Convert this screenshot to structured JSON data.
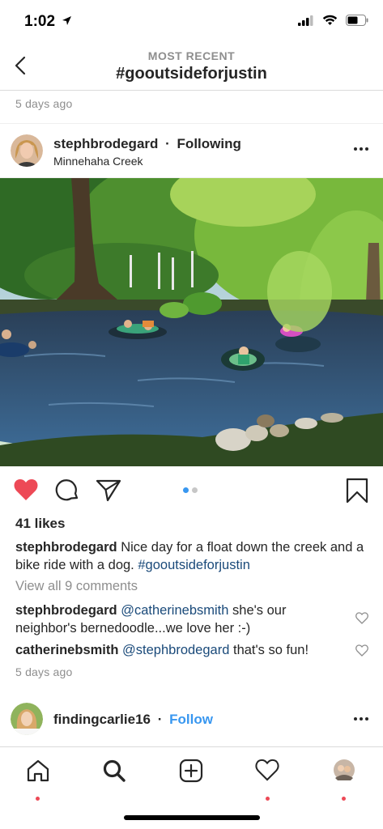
{
  "status_bar": {
    "time": "1:02"
  },
  "header": {
    "subtitle": "MOST RECENT",
    "title": "#gooutsideforjustin"
  },
  "top_timestamp": "5 days ago",
  "post": {
    "username": "stephbrodegard",
    "separator": "·",
    "follow_status": "Following",
    "location": "Minnehaha Creek",
    "carousel": {
      "count": 2,
      "active_index": 0
    },
    "liked": true,
    "likes": "41 likes",
    "caption": {
      "username": "stephbrodegard",
      "text": "Nice day for a float down the creek and a bike ride with a dog.",
      "hashtag": "#gooutsideforjustin"
    },
    "view_all_comments": "View all 9 comments",
    "comments": [
      {
        "username": "stephbrodegard",
        "mention": "@catherinebsmith",
        "text": "she's our neighbor's bernedoodle...we love her :-)"
      },
      {
        "username": "catherinebsmith",
        "mention": "@stephbrodegard",
        "text": "that's so fun!"
      }
    ],
    "timestamp": "5 days ago"
  },
  "next_post": {
    "username": "findingcarlie16",
    "separator": "·",
    "follow_label": "Follow"
  },
  "tab_bar": {
    "items": [
      {
        "icon": "home-icon",
        "notification_dot": true
      },
      {
        "icon": "search-icon",
        "notification_dot": false,
        "active": true
      },
      {
        "icon": "add-post-icon",
        "notification_dot": false
      },
      {
        "icon": "activity-heart-icon",
        "notification_dot": true
      },
      {
        "icon": "profile-avatar-icon",
        "notification_dot": true
      }
    ]
  },
  "colors": {
    "like_red": "#ed4956",
    "link_blue": "#3897f0",
    "mention_blue": "#1a4a7a",
    "muted_gray": "#8e8e8e"
  }
}
